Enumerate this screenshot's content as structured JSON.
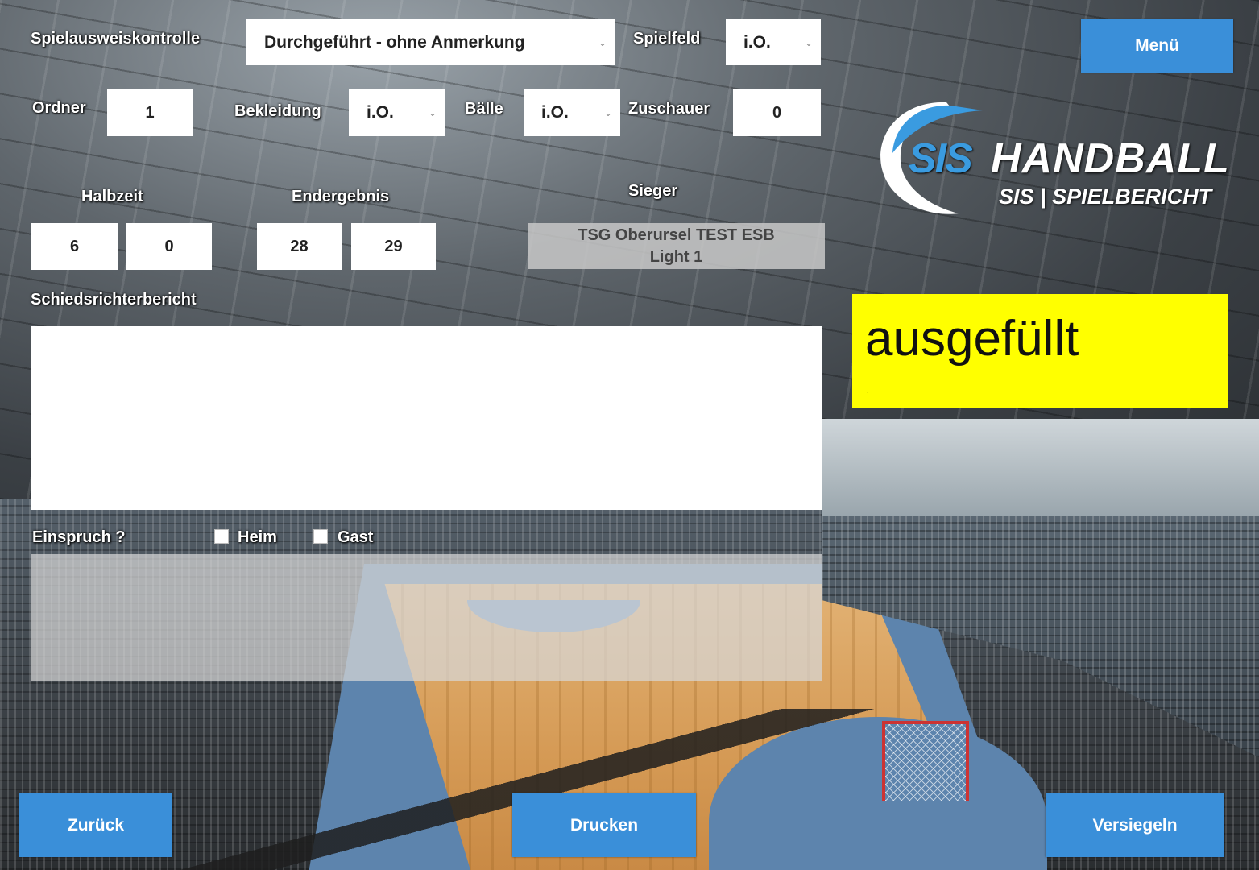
{
  "controls": {
    "spielausweiskontrolle_label": "Spielausweiskontrolle",
    "spielausweiskontrolle_value": "Durchgeführt - ohne Anmerkung",
    "spielfeld_label": "Spielfeld",
    "spielfeld_value": "i.O.",
    "ordner_label": "Ordner",
    "ordner_value": "1",
    "bekleidung_label": "Bekleidung",
    "bekleidung_value": "i.O.",
    "baelle_label": "Bälle",
    "baelle_value": "i.O.",
    "zuschauer_label": "Zuschauer",
    "zuschauer_value": "0"
  },
  "score": {
    "halbzeit_label": "Halbzeit",
    "halbzeit_home": "6",
    "halbzeit_away": "0",
    "endergebnis_label": "Endergebnis",
    "endergebnis_home": "28",
    "endergebnis_away": "29",
    "sieger_label": "Sieger",
    "sieger_value_line1": "TSG Oberursel  TEST ESB",
    "sieger_value_line2": "Light 1"
  },
  "report": {
    "label": "Schiedsrichterbericht",
    "value": ""
  },
  "einspruch": {
    "label": "Einspruch ?",
    "heim_label": "Heim",
    "gast_label": "Gast",
    "heim_checked": false,
    "gast_checked": false
  },
  "menu_label": "Menü",
  "logo": {
    "brand": "SIS",
    "title": "HANDBALL",
    "subtitle": "SIS | SPIELBERICHT",
    "color_blue": "#3a9be0"
  },
  "note": {
    "text": "ausgefüllt",
    "dot": "."
  },
  "footer": {
    "back_label": "Zurück",
    "print_label": "Drucken",
    "seal_label": "Versiegeln"
  },
  "colors": {
    "button": "#3a8fd9",
    "note_bg": "#ffff00"
  }
}
